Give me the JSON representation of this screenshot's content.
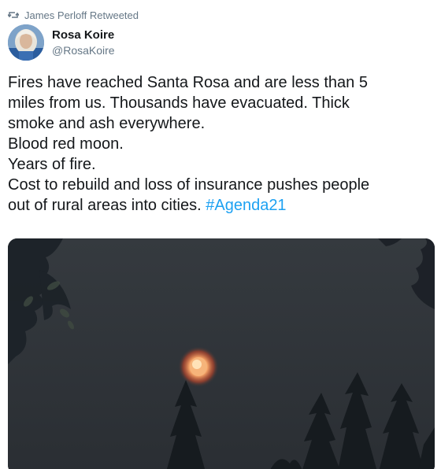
{
  "retweet": {
    "icon": "retweet-icon",
    "label": "James Perloff Retweeted"
  },
  "author": {
    "name": "Rosa Koire",
    "handle": "@RosaKoire",
    "avatar_icon": "avatar"
  },
  "tweet": {
    "lines": [
      "Fires have reached Santa Rosa and are less than 5",
      "miles from us. Thousands have evacuated. Thick",
      "smoke and ash everywhere.",
      "Blood red moon.",
      "Years of fire.",
      "Cost to rebuild and loss of insurance pushes people",
      "out of rural areas into cities. "
    ],
    "hashtag": "#Agenda21"
  },
  "colors": {
    "hashtag": "#1da1f2",
    "muted": "#657786",
    "text": "#14171a",
    "sky": "#2f3439",
    "moon": "#f07a4a"
  }
}
